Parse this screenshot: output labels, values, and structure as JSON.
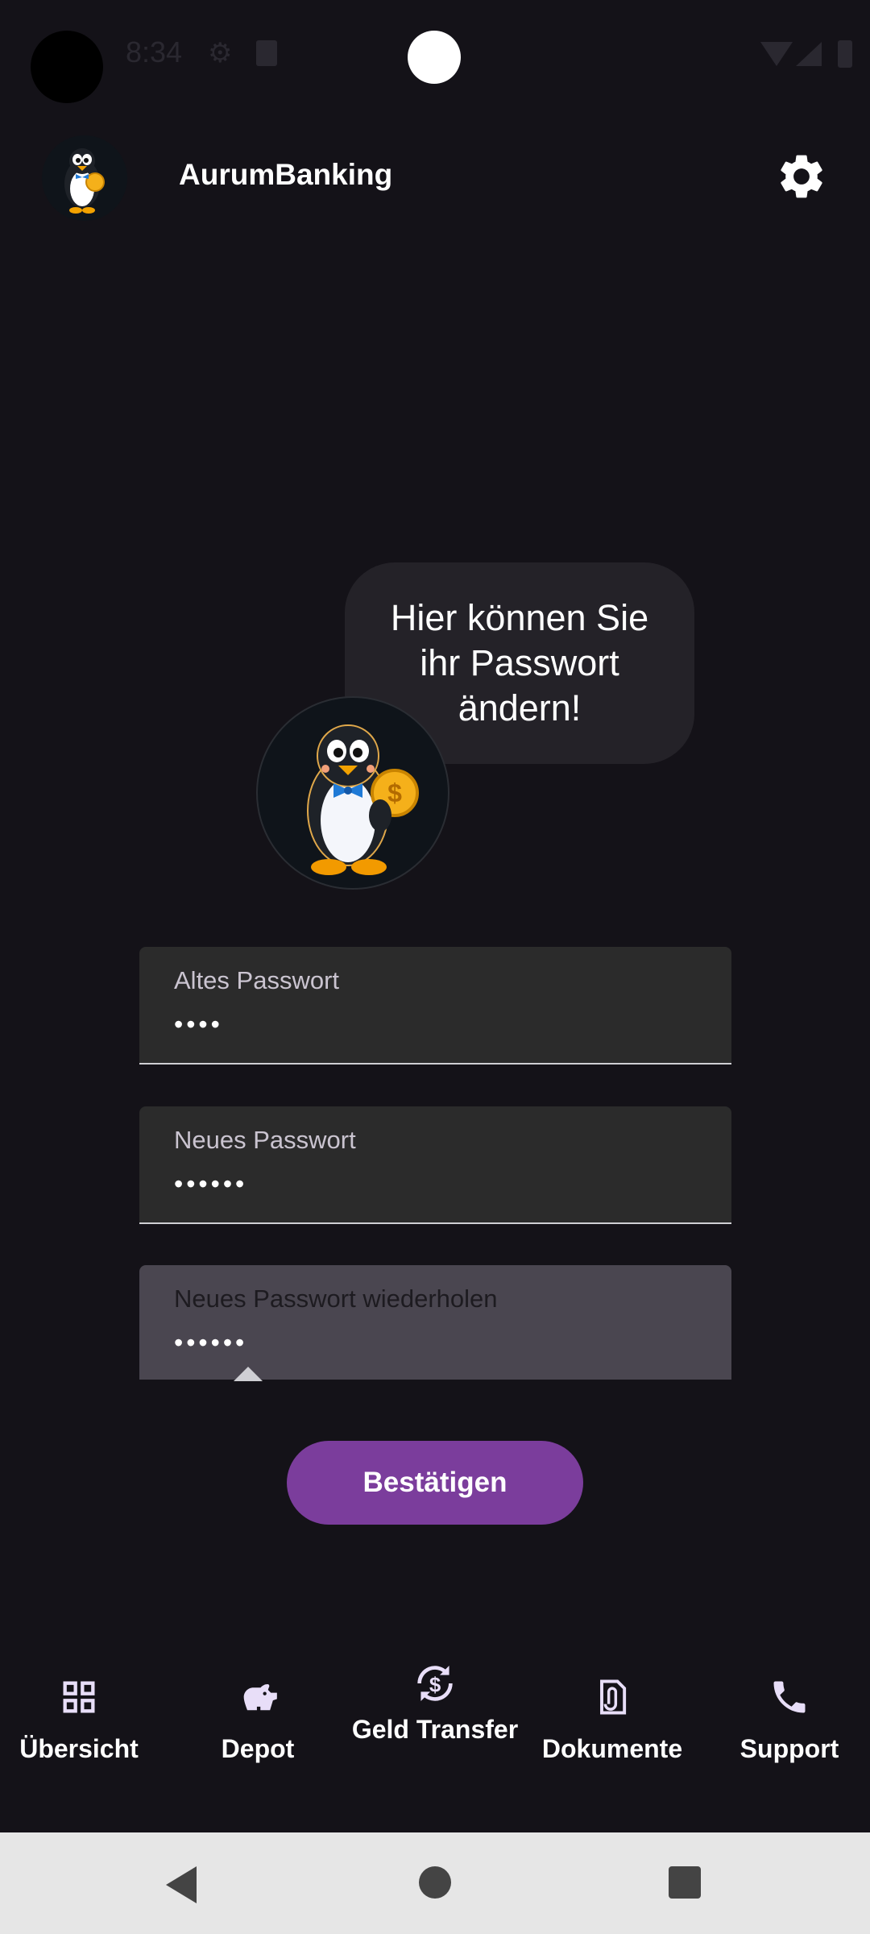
{
  "status_bar": {
    "time": "8:34",
    "icons": [
      "gear-icon",
      "sd-card-icon",
      "wifi-icon",
      "signal-icon",
      "battery-icon"
    ]
  },
  "app_bar": {
    "title": "AurumBanking",
    "logo_icon": "penguin-logo-icon",
    "settings_icon": "gear-icon"
  },
  "bubble": {
    "text": "Hier können Sie ihr Passwort ändern!"
  },
  "form": {
    "old_password": {
      "label": "Altes Passwort",
      "value": "••••"
    },
    "new_password": {
      "label": "Neues Passwort",
      "value": "••••••"
    },
    "repeat_password": {
      "label": "Neues Passwort wiederholen",
      "value": "••••••"
    },
    "confirm_label": "Bestätigen"
  },
  "bottom_nav": {
    "items": [
      {
        "label": "Übersicht",
        "icon": "grid-icon"
      },
      {
        "label": "Depot",
        "icon": "piggy-bank-icon"
      },
      {
        "label": "Geld Transfer",
        "icon": "currency-exchange-icon"
      },
      {
        "label": "Dokumente",
        "icon": "paperclip-document-icon"
      },
      {
        "label": "Support",
        "icon": "phone-icon"
      }
    ]
  },
  "colors": {
    "background": "#141218",
    "bubble": "#242228",
    "field": "#2b2b2b",
    "field_active": "#4a4650",
    "accent": "#7b3d9c",
    "system_nav": "#e6e6e6"
  }
}
